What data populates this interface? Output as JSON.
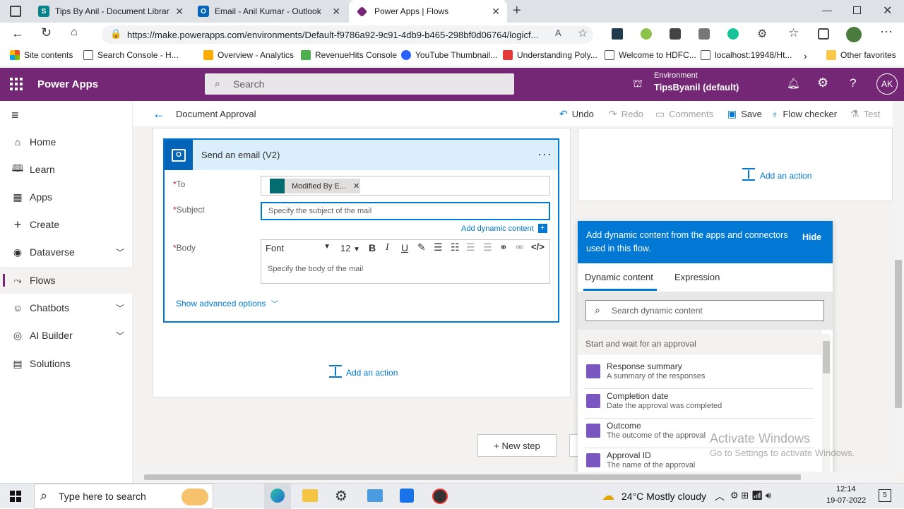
{
  "browser": {
    "tabs": [
      {
        "title": "Tips By Anil - Document Library"
      },
      {
        "title": "Email - Anil Kumar - Outlook"
      },
      {
        "title": "Power Apps | Flows"
      }
    ],
    "url": "https://make.powerapps.com/environments/Default-f9786a92-9c91-4db9-b465-298bf0d06764/logicf...",
    "favorites": [
      {
        "label": "Site contents"
      },
      {
        "label": "Search Console - H..."
      },
      {
        "label": "Overview - Analytics"
      },
      {
        "label": "RevenueHits Console"
      },
      {
        "label": "YouTube Thumbnail..."
      },
      {
        "label": "Understanding Poly..."
      },
      {
        "label": "Welcome to HDFC..."
      },
      {
        "label": "localhost:19948/Ht..."
      }
    ],
    "other_favorites": "Other favorites"
  },
  "app": {
    "name": "Power Apps",
    "search_placeholder": "Search",
    "environment_label": "Environment",
    "environment_name": "TipsByanil (default)",
    "avatar": "AK",
    "accent": "#742774"
  },
  "nav": {
    "items": [
      {
        "label": "Home"
      },
      {
        "label": "Learn"
      },
      {
        "label": "Apps"
      },
      {
        "label": "Create"
      },
      {
        "label": "Dataverse"
      },
      {
        "label": "Flows"
      },
      {
        "label": "Chatbots"
      },
      {
        "label": "AI Builder"
      },
      {
        "label": "Solutions"
      }
    ]
  },
  "flow": {
    "title": "Document Approval",
    "commands": {
      "undo": "Undo",
      "redo": "Redo",
      "comments": "Comments",
      "save": "Save",
      "flow_checker": "Flow checker",
      "test": "Test"
    },
    "card": {
      "title": "Send an email (V2)",
      "to_label": "To",
      "to_token": "Modified By E...",
      "subject_label": "Subject",
      "subject_placeholder": "Specify the subject of the mail",
      "add_dynamic": "Add dynamic content",
      "body_label": "Body",
      "font": "Font",
      "font_size": "12",
      "body_placeholder": "Specify the body of the mail",
      "show_advanced": "Show advanced options"
    },
    "add_action": "Add an action",
    "new_step": "+ New step"
  },
  "dynamic": {
    "header": "Add dynamic content from the apps and connectors used in this flow.",
    "hide": "Hide",
    "tab_dynamic": "Dynamic content",
    "tab_expression": "Expression",
    "search_placeholder": "Search dynamic content",
    "section": "Start and wait for an approval",
    "items": [
      {
        "title": "Response summary",
        "desc": "A summary of the responses"
      },
      {
        "title": "Completion date",
        "desc": "Date the approval was completed"
      },
      {
        "title": "Outcome",
        "desc": "The outcome of the approval"
      },
      {
        "title": "Approval ID",
        "desc": "The name of the approval"
      }
    ]
  },
  "watermark": {
    "line1": "Activate Windows",
    "line2": "Go to Settings to activate Windows."
  },
  "taskbar": {
    "search_placeholder": "Type here to search",
    "weather": "24°C  Mostly cloudy",
    "time": "12:14",
    "date": "19-07-2022",
    "notification_count": "5"
  }
}
